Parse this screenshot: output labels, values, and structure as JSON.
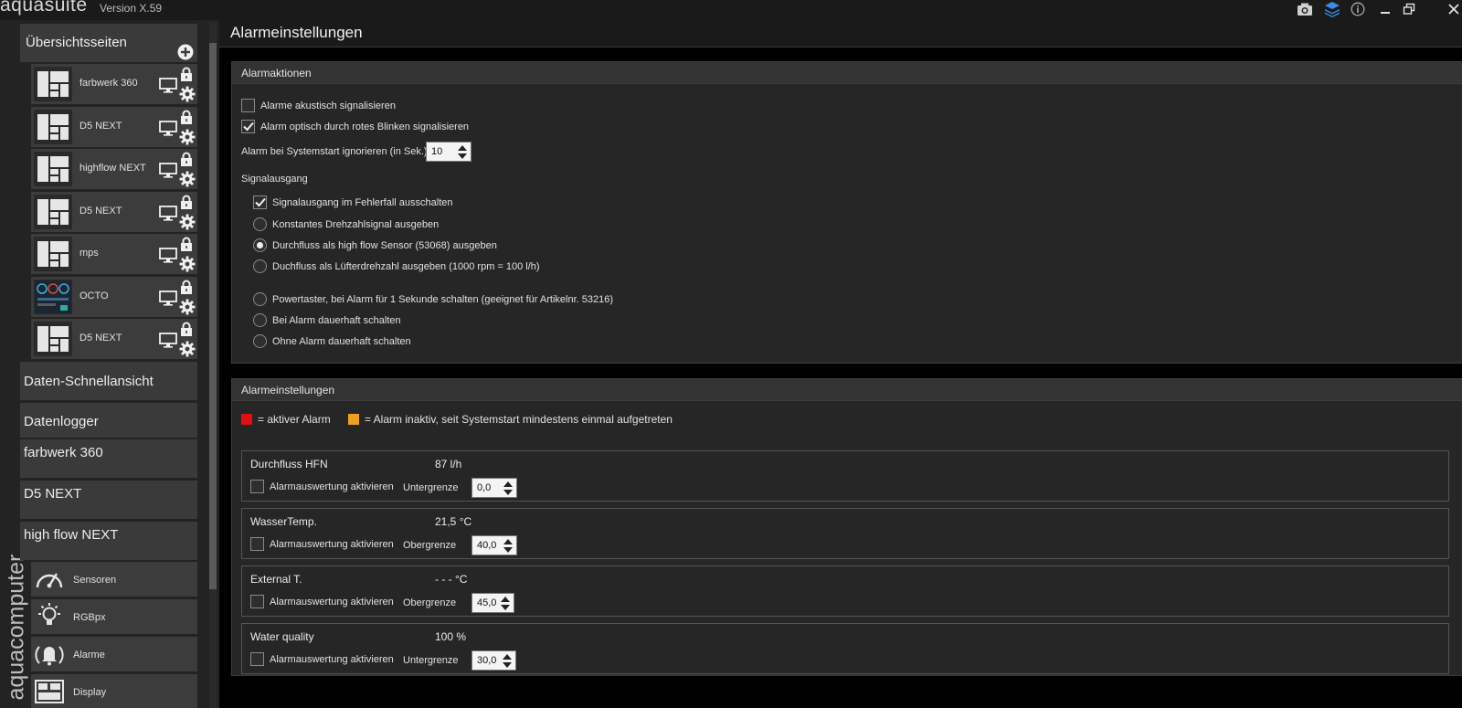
{
  "app": {
    "logo_text": "aquasuite",
    "version": "Version X.59",
    "brand_vertical": "aquacomputer"
  },
  "sidebar": {
    "overview_label": "Übersichtsseiten",
    "pages": [
      {
        "name": "farbwerk 360"
      },
      {
        "name": "D5 NEXT"
      },
      {
        "name": "highflow NEXT"
      },
      {
        "name": "D5 NEXT"
      },
      {
        "name": "mps"
      },
      {
        "name": "OCTO"
      },
      {
        "name": "D5 NEXT"
      }
    ],
    "items": [
      {
        "label": "Daten-Schnellansicht"
      },
      {
        "label": "Datenlogger"
      },
      {
        "label": "farbwerk 360"
      },
      {
        "label": "D5 NEXT"
      },
      {
        "label": "high flow NEXT"
      }
    ],
    "tools": [
      {
        "label": "Sensoren",
        "icon": "gauge-icon"
      },
      {
        "label": "RGBpx",
        "icon": "bulb-icon"
      },
      {
        "label": "Alarme",
        "icon": "alarm-bell-icon"
      },
      {
        "label": "Display",
        "icon": "display-grid-icon"
      }
    ]
  },
  "main": {
    "title": "Alarmeinstellungen",
    "actions": {
      "header": "Alarmaktionen",
      "acoustic_label": "Alarme akustisch signalisieren",
      "acoustic_checked": false,
      "optical_label": "Alarm optisch durch rotes Blinken signalisieren",
      "optical_checked": true,
      "startup_label": "Alarm bei Systemstart ignorieren (in Sek.)",
      "startup_value": "10",
      "signal_header": "Signalausgang",
      "signal_off_label": "Signalausgang im Fehlerfall ausschalten",
      "signal_off_checked": true,
      "radios": [
        {
          "label": "Konstantes Drehzahlsignal ausgeben",
          "selected": false
        },
        {
          "label": "Durchfluss als high flow Sensor (53068) ausgeben",
          "selected": true
        },
        {
          "label": "Duchfluss als Lüfterdrehzahl ausgeben (1000 rpm = 100 l/h)",
          "selected": false
        },
        {
          "label": "Powertaster, bei Alarm für 1 Sekunde schalten (geeignet für Artikelnr. 53216)",
          "selected": false
        },
        {
          "label": "Bei Alarm dauerhaft schalten",
          "selected": false
        },
        {
          "label": "Ohne Alarm dauerhaft schalten",
          "selected": false
        }
      ]
    },
    "settings": {
      "header": "Alarmeinstellungen",
      "legend_active": "= aktiver Alarm",
      "legend_inactive": "= Alarm inaktiv, seit Systemstart mindestens einmal aufgetreten",
      "color_active": "#e01010",
      "color_inactive": "#f0a020",
      "alarms": [
        {
          "name": "Durchfluss HFN",
          "value": "87 l/h",
          "enable_label": "Alarmauswertung aktivieren",
          "limit_label": "Untergrenze",
          "limit_value": "0,0"
        },
        {
          "name": "WasserTemp.",
          "value": "21,5 °C",
          "enable_label": "Alarmauswertung aktivieren",
          "limit_label": "Obergrenze",
          "limit_value": "40,0"
        },
        {
          "name": "External T.",
          "value": "- - - °C",
          "enable_label": "Alarmauswertung aktivieren",
          "limit_label": "Obergrenze",
          "limit_value": "45,0"
        },
        {
          "name": "Water quality",
          "value": "100 %",
          "enable_label": "Alarmauswertung aktivieren",
          "limit_label": "Untergrenze",
          "limit_value": "30,0"
        }
      ]
    }
  }
}
